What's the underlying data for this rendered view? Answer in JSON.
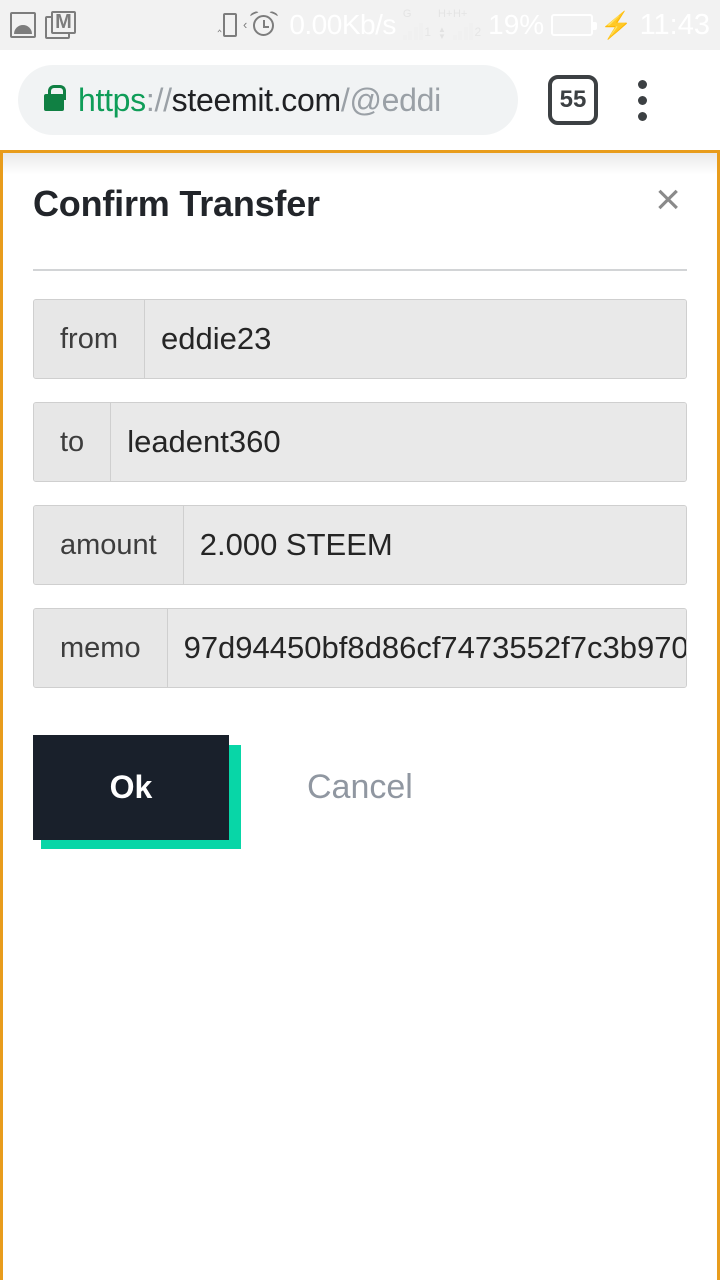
{
  "status_bar": {
    "left_icons": [
      {
        "name": "photo-icon",
        "label": "image"
      },
      {
        "name": "gmail-icon",
        "label": "M"
      }
    ],
    "vibrate_icon": "vibrate-icon",
    "alarm_icon": "alarm-clock-icon",
    "network_speed": "0.00Kb/s",
    "sim1": {
      "label": "G",
      "subscript": "1"
    },
    "sim2": {
      "label": "H+",
      "subscript": "2"
    },
    "sim2_alt_label": "H+",
    "battery_percent": "19%",
    "battery_level": 19,
    "charging": true,
    "time": "11:43"
  },
  "browser": {
    "url": {
      "scheme": "https",
      "separator": "://",
      "host": "steemit.com",
      "slash": "/",
      "path": "@eddi"
    },
    "tab_count": "55",
    "menu_label": "More options"
  },
  "dialog": {
    "title": "Confirm Transfer",
    "close_label": "×",
    "fields": [
      {
        "label": "from",
        "value": "eddie23"
      },
      {
        "label": "to",
        "value": "leadent360"
      },
      {
        "label": "amount",
        "value": "2.000 STEEM"
      },
      {
        "label": "memo",
        "value": "97d94450bf8d86cf7473552f7c3b970"
      }
    ],
    "ok_label": "Ok",
    "cancel_label": "Cancel"
  },
  "colors": {
    "accent_teal": "#08d6a7",
    "button_dark": "#19202b",
    "page_border_orange": "#e89c1c",
    "url_secure_green": "#0f9d58",
    "battery_green": "#55d65e"
  }
}
